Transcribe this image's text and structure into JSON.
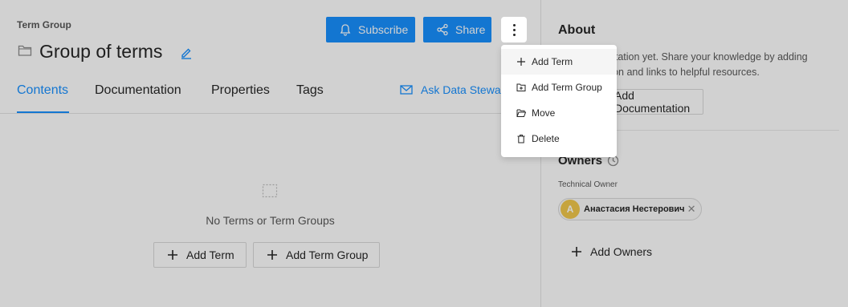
{
  "header": {
    "type_label": "Term Group",
    "title": "Group of terms",
    "subscribe_label": "Subscribe",
    "share_label": "Share"
  },
  "tabs": [
    {
      "label": "Contents",
      "active": true
    },
    {
      "label": "Documentation",
      "active": false
    },
    {
      "label": "Properties",
      "active": false
    },
    {
      "label": "Tags",
      "active": false
    }
  ],
  "ask_steward_label": "Ask Data Steward",
  "empty_state": {
    "text": "No Terms or Term Groups",
    "add_term_label": "Add Term",
    "add_term_group_label": "Add Term Group"
  },
  "sidebar": {
    "about_title": "About",
    "about_text": "No documentation yet. Share your knowledge by adding documentation and links to helpful resources.",
    "add_documentation_label": "Add Documentation",
    "owners_title": "Owners",
    "technical_owner_label": "Technical Owner",
    "owner_initial": "A",
    "owner_name": "Анастасия Нестерович",
    "add_owners_label": "Add Owners"
  },
  "menu": {
    "items": [
      {
        "label": "Add Term",
        "icon": "plus-icon"
      },
      {
        "label": "Add Term Group",
        "icon": "folder-add-icon"
      },
      {
        "label": "Move",
        "icon": "folder-open-icon"
      },
      {
        "label": "Delete",
        "icon": "trash-icon"
      }
    ]
  },
  "colors": {
    "primary": "#1890ff",
    "avatar": "#f2c94c",
    "overlay": "rgba(0,0,0,0.18)"
  }
}
